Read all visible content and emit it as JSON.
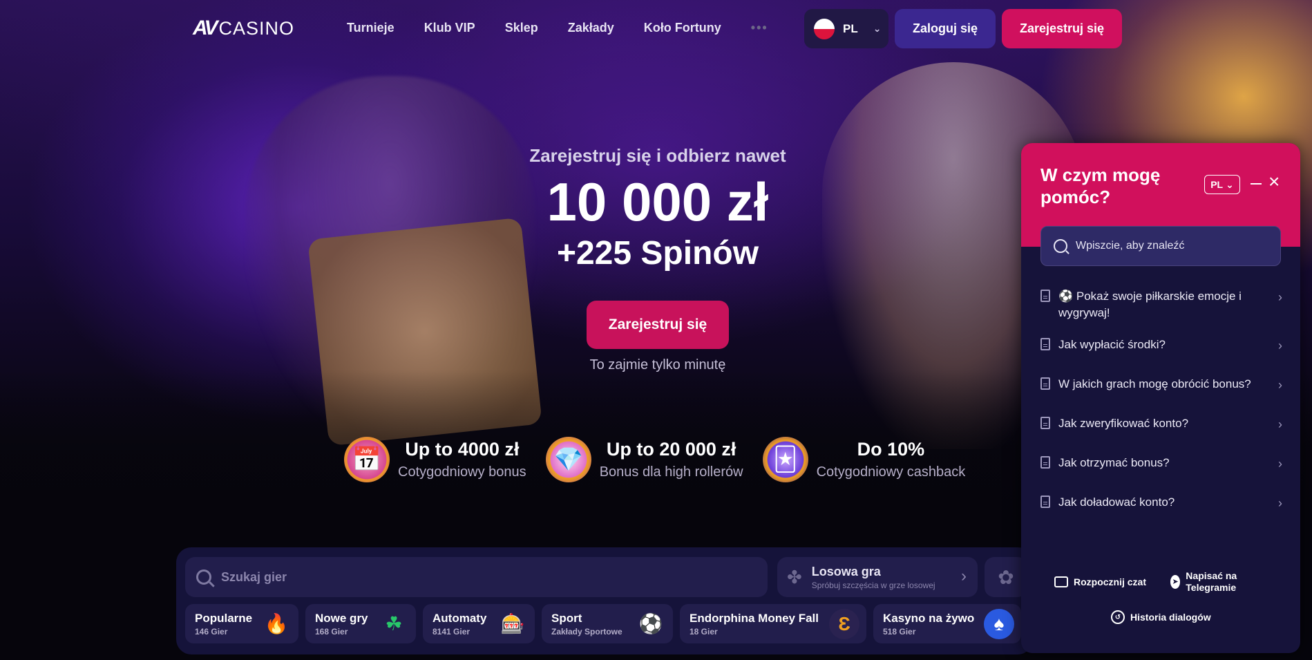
{
  "nav": {
    "logo_mark": "AV",
    "logo_word": "CASINO",
    "menu": [
      "Turnieje",
      "Klub VIP",
      "Sklep",
      "Zakłady",
      "Koło Fortuny"
    ],
    "more": "•••",
    "lang": "PL",
    "login": "Zaloguj się",
    "register": "Zarejestruj się"
  },
  "hero": {
    "sub": "Zarejestruj się i odbierz nawet",
    "amount": "10 000 zł",
    "spins": "+225 Spinów",
    "cta": "Zarejestruj się",
    "note": "To zajmie tylko minutę"
  },
  "promos": [
    {
      "title": "Up to 4000 zł",
      "sub": "Cotygodniowy bonus",
      "icon": "calendar-icon"
    },
    {
      "title": "Up to 20 000 zł",
      "sub": "Bonus dla high rollerów",
      "icon": "crystal-icon"
    },
    {
      "title": "Do 10%",
      "sub": "Cotygodniowy cashback",
      "icon": "cards-icon"
    }
  ],
  "games": {
    "search_placeholder": "Szukaj gier",
    "random_title": "Losowa gra",
    "random_sub": "Spróbuj szczęścia w grze losowej",
    "categories": [
      {
        "name": "Popularne",
        "count": "146 Gier",
        "icon": "fire-icon",
        "color": "#ff6a1a"
      },
      {
        "name": "Nowe gry",
        "count": "168 Gier",
        "icon": "clover-icon",
        "color": "#28c86a"
      },
      {
        "name": "Automaty",
        "count": "8141 Gier",
        "icon": "slot-icon",
        "color": "#ff5a9a"
      },
      {
        "name": "Sport",
        "count": "Zakłady Sportowe",
        "icon": "ball-icon",
        "color": "#ffffff"
      },
      {
        "name": "Endorphina Money Fall",
        "count": "18 Gier",
        "icon": "endorphina-icon",
        "color": "#3a3a80"
      },
      {
        "name": "Kasyno na żywo",
        "count": "518 Gier",
        "icon": "chip-icon",
        "color": "#2a5ae0"
      }
    ]
  },
  "chat": {
    "title": "W czym mogę pomóc?",
    "lang": "PL",
    "search_placeholder": "Wpiszcie, aby znaleźć",
    "faq": [
      "⚽ Pokaż swoje piłkarskie emocje i wygrywaj!",
      "Jak wypłacić środki?",
      "W jakich grach mogę obrócić bonus?",
      "Jak zweryfikować konto?",
      "Jak otrzymać bonus?",
      "Jak doładować konto?"
    ],
    "start_chat": "Rozpocznij czat",
    "telegram": "Napisać na Telegramie",
    "history": "Historia dialogów"
  },
  "colors": {
    "brand_pink": "#d0105e",
    "login_purple": "#3b2790",
    "panel": "#16133a"
  }
}
